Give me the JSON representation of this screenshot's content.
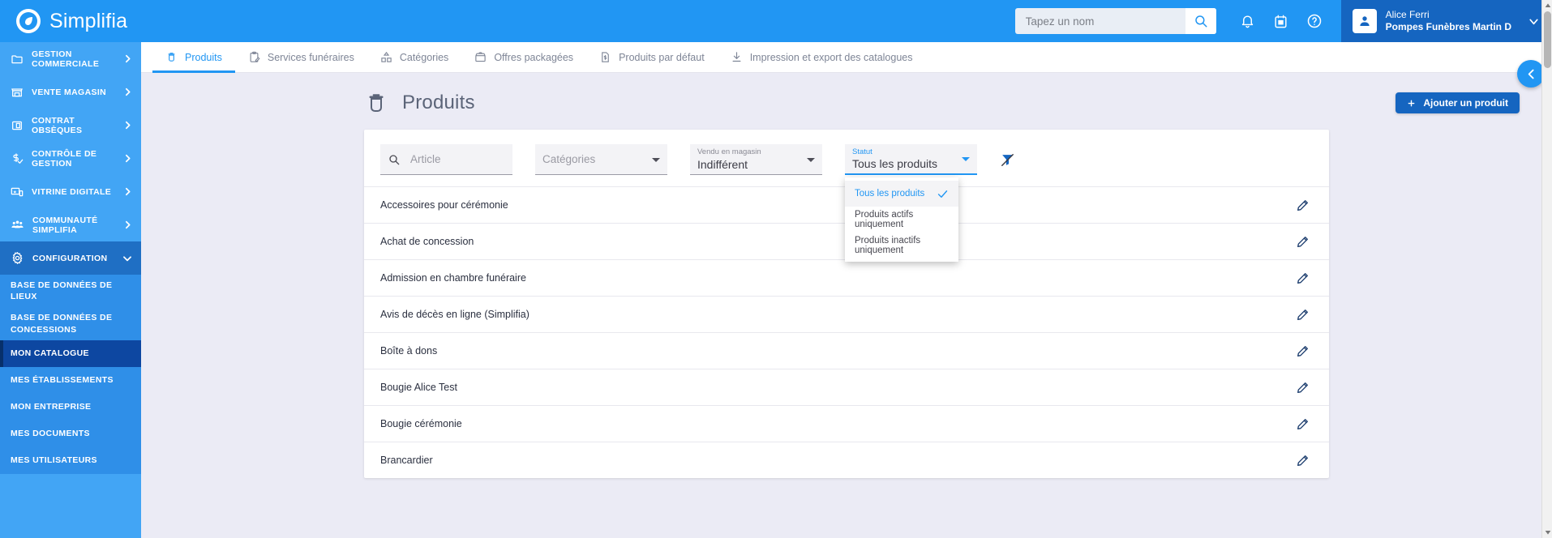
{
  "brand": {
    "name": "Simplifia",
    "logo_icon": "simplifia-logo-icon"
  },
  "colors": {
    "primary": "#2196f3",
    "sidebar": "#42a5f5",
    "sidebar_sub": "#2f8fe8",
    "active_item": "#0d47a1",
    "button": "#1565c0",
    "page_bg": "#ebebf5",
    "text_dark": "#2b3040",
    "text_muted": "#7e8596"
  },
  "topbar": {
    "search": {
      "placeholder": "Tapez un nom",
      "value": "",
      "icon": "search-icon"
    },
    "icons": [
      {
        "name": "notifications-icon",
        "glyph": "bell"
      },
      {
        "name": "calendar-icon",
        "glyph": "calendar"
      },
      {
        "name": "help-icon",
        "glyph": "question-circle"
      }
    ],
    "user": {
      "avatar_icon": "user-avatar-icon",
      "name": "Alice Ferri",
      "organisation": "Pompes Funèbres Martin D",
      "chevron_icon": "chevron-down-icon"
    }
  },
  "sidebar": {
    "groups": [
      {
        "label": "GESTION COMMERCIALE",
        "icon": "folder-icon",
        "chevron": "chevron-right-icon",
        "active": false
      },
      {
        "label": "VENTE MAGASIN",
        "icon": "store-icon",
        "chevron": "chevron-right-icon",
        "active": false
      },
      {
        "label": "CONTRAT OBSÈQUES",
        "icon": "contract-icon",
        "chevron": "chevron-right-icon",
        "active": false
      },
      {
        "label": "CONTRÔLE DE GESTION",
        "icon": "money-check-icon",
        "chevron": "chevron-right-icon",
        "active": false
      },
      {
        "label": "VITRINE DIGITALE",
        "icon": "display-icon",
        "chevron": "chevron-right-icon",
        "active": false
      },
      {
        "label": "COMMUNAUTÉ SIMPLIFIA",
        "icon": "people-group-icon",
        "chevron": "chevron-right-icon",
        "active": false
      },
      {
        "label": "CONFIGURATION",
        "icon": "gear-icon",
        "chevron": "chevron-down-icon",
        "active": true
      }
    ],
    "sub_items": [
      {
        "label": "BASE DE DONNÉES DE LIEUX",
        "active": false
      },
      {
        "label": "BASE DE DONNÉES DE CONCESSIONS",
        "active": false
      },
      {
        "label": "MON CATALOGUE",
        "active": true
      },
      {
        "label": "MES ÉTABLISSEMENTS",
        "active": false
      },
      {
        "label": "MON ENTREPRISE",
        "active": false
      },
      {
        "label": "MES DOCUMENTS",
        "active": false
      },
      {
        "label": "MES UTILISATEURS",
        "active": false
      }
    ]
  },
  "tabs": [
    {
      "label": "Produits",
      "icon": "urn-icon",
      "active": true
    },
    {
      "label": "Services funéraires",
      "icon": "clipboard-icon",
      "active": false
    },
    {
      "label": "Catégories",
      "icon": "category-icon",
      "active": false
    },
    {
      "label": "Offres packagées",
      "icon": "package-icon",
      "active": false
    },
    {
      "label": "Produits par défaut",
      "icon": "document-price-icon",
      "active": false
    },
    {
      "label": "Impression et export des catalogues",
      "icon": "download-icon",
      "active": false
    }
  ],
  "collapse_toggle": {
    "icon": "chevron-left-icon"
  },
  "page": {
    "title": "Produits",
    "title_icon": "urn-icon",
    "add_button": {
      "label": "Ajouter un produit",
      "icon": "plus-icon"
    }
  },
  "filters": {
    "article": {
      "placeholder": "Article",
      "value": "",
      "icon": "search-icon"
    },
    "categories": {
      "placeholder": "Catégories",
      "value": "",
      "caret": "caret-down-icon"
    },
    "vendu_en_magasin": {
      "label": "Vendu en magasin",
      "value": "Indifférent",
      "caret": "caret-down-icon"
    },
    "statut": {
      "label": "Statut",
      "value": "Tous les produits",
      "caret": "caret-down-icon",
      "open": true,
      "options": [
        {
          "label": "Tous les produits",
          "selected": true,
          "check_icon": "check-icon"
        },
        {
          "label": "Produits actifs uniquement",
          "selected": false
        },
        {
          "label": "Produits inactifs uniquement",
          "selected": false
        }
      ]
    },
    "clear_filter": {
      "icon": "filter-off-icon"
    }
  },
  "products": [
    {
      "name": "Accessoires pour cérémonie",
      "edit_icon": "pencil-icon"
    },
    {
      "name": "Achat de concession",
      "edit_icon": "pencil-icon"
    },
    {
      "name": "Admission en chambre funéraire",
      "edit_icon": "pencil-icon"
    },
    {
      "name": "Avis de décès en ligne (Simplifia)",
      "edit_icon": "pencil-icon"
    },
    {
      "name": "Boîte à dons",
      "edit_icon": "pencil-icon"
    },
    {
      "name": "Bougie Alice Test",
      "edit_icon": "pencil-icon"
    },
    {
      "name": "Bougie cérémonie",
      "edit_icon": "pencil-icon"
    },
    {
      "name": "Brancardier",
      "edit_icon": "pencil-icon"
    }
  ],
  "scrollbar": {
    "up_icon": "scroll-up-icon",
    "down_icon": "scroll-down-icon"
  }
}
